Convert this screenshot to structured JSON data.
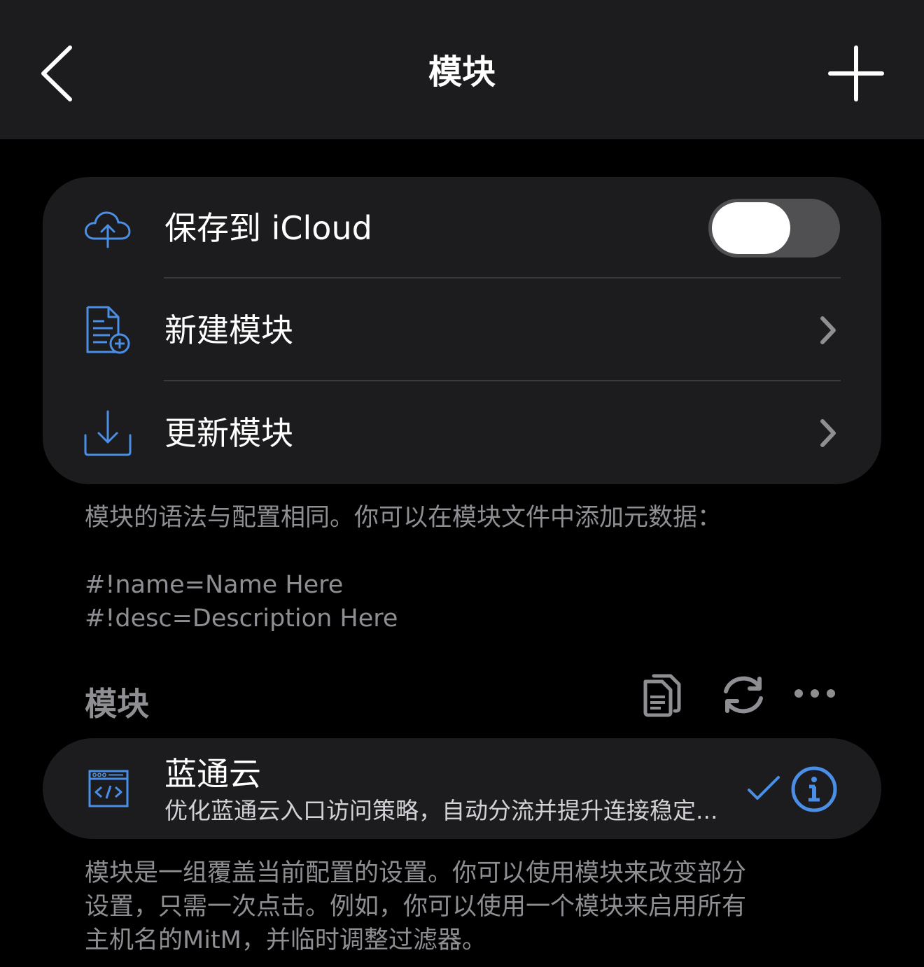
{
  "navbar": {
    "title": "模块",
    "back_icon": "chevron-left-icon",
    "add_icon": "plus-icon"
  },
  "settings": {
    "items": [
      {
        "label": "保存到 iCloud",
        "icon": "cloud-upload-icon",
        "control": "toggle",
        "toggle_on": false
      },
      {
        "label": "新建模块",
        "icon": "new-document-icon",
        "control": "chevron"
      },
      {
        "label": "更新模块",
        "icon": "download-icon",
        "control": "chevron"
      }
    ]
  },
  "syntax_note": {
    "line1": "模块的语法与配置相同。你可以在模块文件中添加元数据：",
    "line2": "#!name=Name Here",
    "line3": "#!desc=Description Here"
  },
  "modules_section": {
    "header": "模块",
    "actions": [
      "copy-icon",
      "refresh-icon",
      "more-icon"
    ],
    "items": [
      {
        "title": "蓝通云",
        "description": "优化蓝通云入口访问策略，自动分流并提升连接稳定...",
        "enabled": true,
        "icon": "code-window-icon",
        "info_icon": "info-icon"
      }
    ]
  },
  "footer_note": {
    "line1": "模块是一组覆盖当前配置的设置。你可以使用模块来改变部分",
    "line2": "设置，只需一次点击。例如，你可以使用一个模块来启用所有",
    "line3": "主机名的MitM，并临时调整过滤器。"
  },
  "colors": {
    "background": "#000000",
    "card": "#1c1c1e",
    "accent": "#4a8ee6",
    "secondary_text": "#8e8e93"
  }
}
